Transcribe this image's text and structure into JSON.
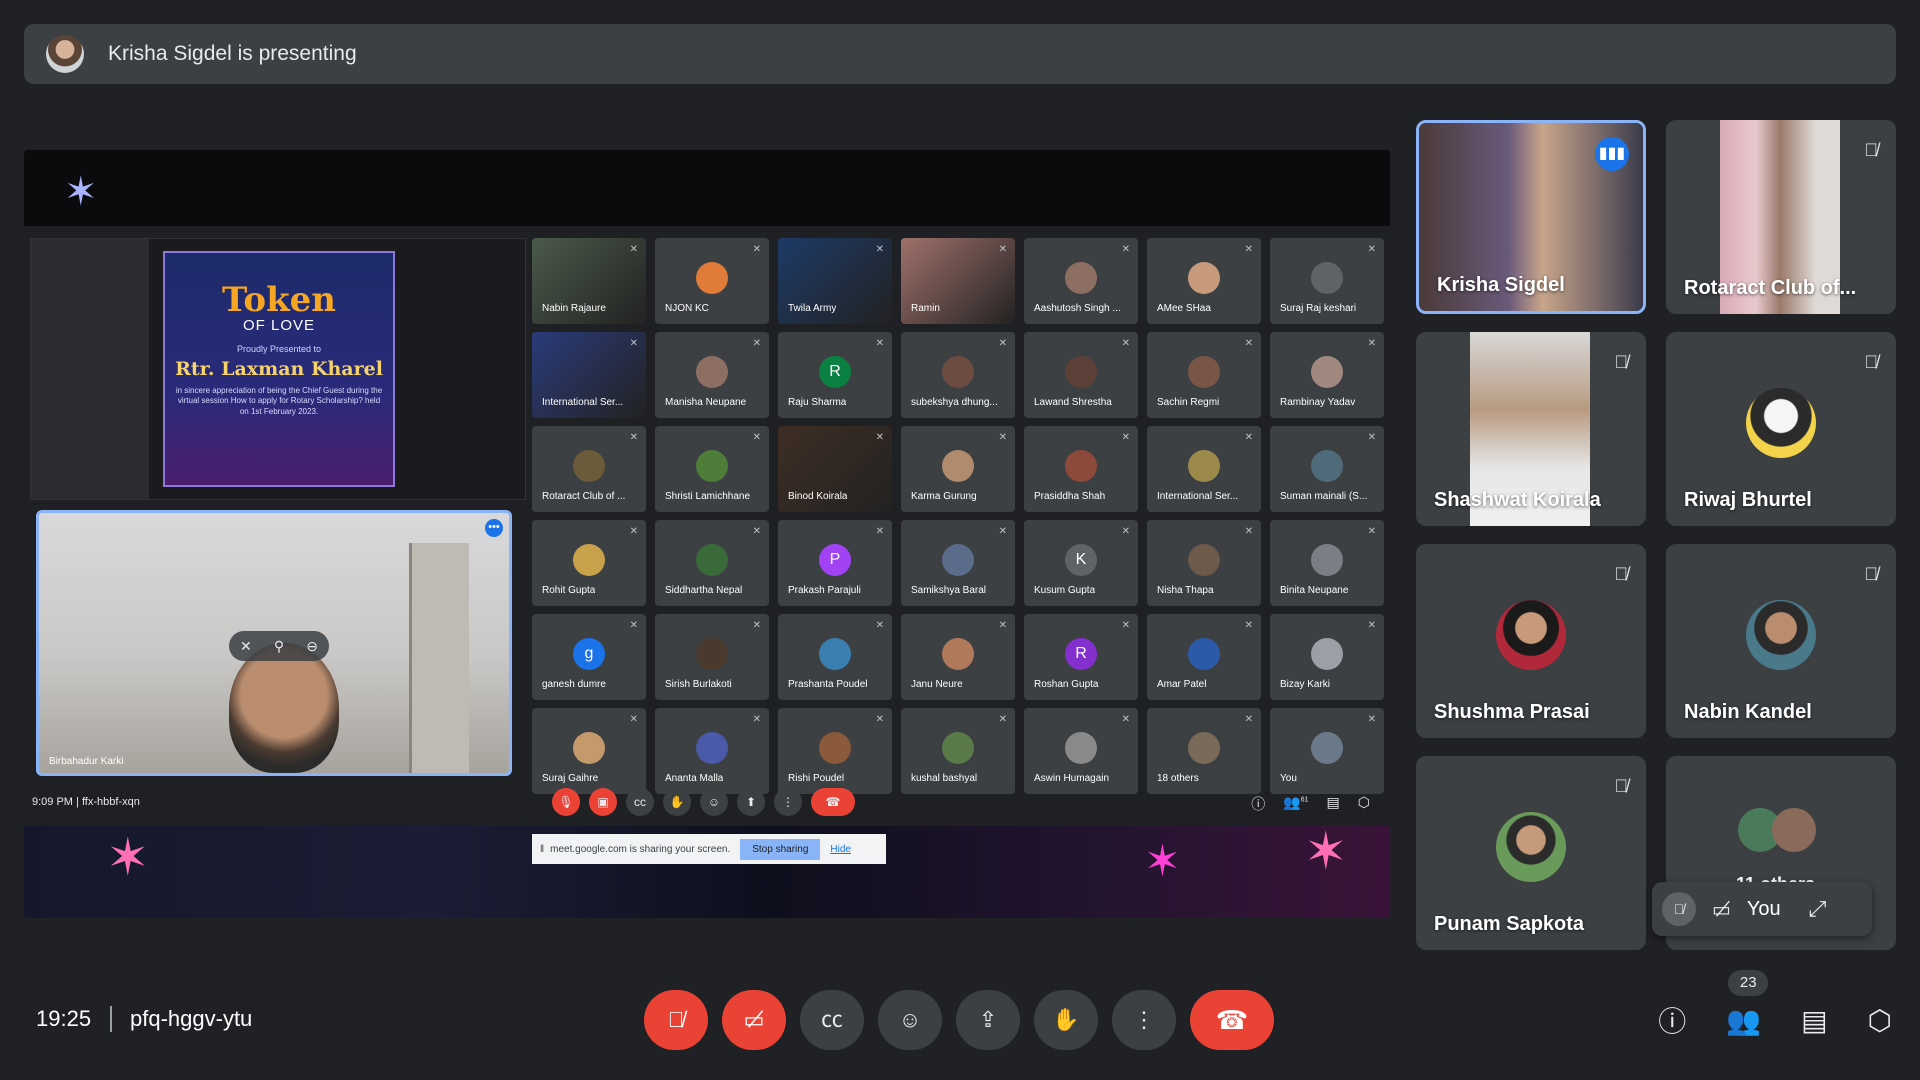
{
  "banner": {
    "text": "Krisha Sigdel is presenting"
  },
  "shared_screen": {
    "token": {
      "title": "Token",
      "subtitle": "OF LOVE",
      "presented": "Proudly Presented to",
      "name": "Rtr. Laxman Kharel",
      "body": "in sincere appreciation of being the Chief Guest during the virtual session How to apply for Rotary Scholarship? held on 1st February 2023."
    },
    "self_view": {
      "name": "Birbahadur Karki"
    },
    "participants": [
      {
        "name": "Nabin Rajaure",
        "initial": "",
        "color": "#4b5a4a",
        "video": true
      },
      {
        "name": "NJON KC",
        "initial": "",
        "color": "#e07b39",
        "video": false
      },
      {
        "name": "Twila Army",
        "initial": "",
        "color": "#1d3a66",
        "video": true
      },
      {
        "name": "Ramin",
        "initial": "",
        "color": "#a0716b",
        "video": true
      },
      {
        "name": "Aashutosh Singh ...",
        "initial": "",
        "color": "#8d6e63",
        "video": false
      },
      {
        "name": "AMee SHaa",
        "initial": "",
        "color": "#c79a7b",
        "video": false
      },
      {
        "name": "Suraj Raj keshari",
        "initial": "",
        "color": "#5f6368",
        "video": false
      },
      {
        "name": "International Ser...",
        "initial": "",
        "color": "#2b3b7a",
        "video": true
      },
      {
        "name": "Manisha Neupane",
        "initial": "",
        "color": "#8d6e63",
        "video": false
      },
      {
        "name": "Raju Sharma",
        "initial": "R",
        "color": "#0b8043",
        "video": false
      },
      {
        "name": "subekshya dhung...",
        "initial": "",
        "color": "#6d4c41",
        "video": false
      },
      {
        "name": "Lawand Shrestha",
        "initial": "",
        "color": "#5d4037",
        "video": false
      },
      {
        "name": "Sachin Regmi",
        "initial": "",
        "color": "#795548",
        "video": false
      },
      {
        "name": "Rambinay Yadav",
        "initial": "",
        "color": "#a1887f",
        "video": false
      },
      {
        "name": "Rotaract Club of ...",
        "initial": "",
        "color": "#6b5b3a",
        "video": false
      },
      {
        "name": "Shristi Lamichhane",
        "initial": "",
        "color": "#4e7d3a",
        "video": false
      },
      {
        "name": "Binod Koirala",
        "initial": "",
        "color": "#3e2e24",
        "video": true
      },
      {
        "name": "Karma Gurung",
        "initial": "",
        "color": "#b08b6e",
        "video": false
      },
      {
        "name": "Prasiddha Shah",
        "initial": "",
        "color": "#8d4a3a",
        "video": false
      },
      {
        "name": "International Ser...",
        "initial": "",
        "color": "#9c8a4a",
        "video": false
      },
      {
        "name": "Suman mainali (S...",
        "initial": "",
        "color": "#4f6b7a",
        "video": false
      },
      {
        "name": "Rohit Gupta",
        "initial": "",
        "color": "#c8a24a",
        "video": false
      },
      {
        "name": "Siddhartha Nepal",
        "initial": "",
        "color": "#3a6a3a",
        "video": false
      },
      {
        "name": "Prakash Parajuli",
        "initial": "P",
        "color": "#a142f4",
        "video": false
      },
      {
        "name": "Samikshya Baral",
        "initial": "",
        "color": "#5b6b8a",
        "video": false
      },
      {
        "name": "Kusum Gupta",
        "initial": "K",
        "color": "#5f6368",
        "video": false
      },
      {
        "name": "Nisha Thapa",
        "initial": "",
        "color": "#6d5a4a",
        "video": false
      },
      {
        "name": "Binita Neupane",
        "initial": "",
        "color": "#7a7f86",
        "video": false
      },
      {
        "name": "ganesh dumre",
        "initial": "g",
        "color": "#1a73e8",
        "video": false
      },
      {
        "name": "Sirish Burlakoti",
        "initial": "",
        "color": "#4a3a2e",
        "video": false
      },
      {
        "name": "Prashanta Poudel",
        "initial": "",
        "color": "#3a7fb0",
        "video": false
      },
      {
        "name": "Janu Neure",
        "initial": "",
        "color": "#b07a5a",
        "video": false
      },
      {
        "name": "Roshan Gupta",
        "initial": "R",
        "color": "#8430ce",
        "video": false
      },
      {
        "name": "Amar Patel",
        "initial": "",
        "color": "#2b5aa8",
        "video": false
      },
      {
        "name": "Bizay Karki",
        "initial": "",
        "color": "#9aa0a6",
        "video": false
      },
      {
        "name": "Suraj Gaihre",
        "initial": "",
        "color": "#c49a6c",
        "video": false
      },
      {
        "name": "Ananta Malla",
        "initial": "",
        "color": "#4a5aa8",
        "video": false
      },
      {
        "name": "Rishi Poudel",
        "initial": "",
        "color": "#8a5a3a",
        "video": false
      },
      {
        "name": "kushal bashyal",
        "initial": "",
        "color": "#5a7a4a",
        "video": false
      },
      {
        "name": "Aswin Humagain",
        "initial": "",
        "color": "#8a8a8a",
        "video": false
      },
      {
        "name": "18 others",
        "initial": "",
        "color": "#7a6a5a",
        "video": false
      },
      {
        "name": "You",
        "initial": "",
        "color": "#6a7a8a",
        "video": false
      }
    ],
    "inner_time": "9:09 PM",
    "inner_code": "ffx-hbbf-xqn",
    "inner_count": "61",
    "share_notice": "meet.google.com is sharing your screen.",
    "stop_sharing": "Stop sharing",
    "hide": "Hide"
  },
  "tiles": {
    "krisha": "Krisha Sigdel",
    "rotaract": "Rotaract Club of...",
    "shashwat": "Shashwat Koirala",
    "riwaj": "Riwaj Bhurtel",
    "shushma": "Shushma Prasai",
    "nabin": "Nabin Kandel",
    "punam": "Punam Sapkota",
    "others": "11 others"
  },
  "self_pill": {
    "label": "You"
  },
  "bottom": {
    "time": "19:25",
    "meeting_code": "pfq-hggv-ytu",
    "participant_count": "23"
  },
  "colors": {
    "accent": "#8ab4f8",
    "danger": "#ea4335",
    "surface": "#3c4043",
    "background": "#202124"
  }
}
